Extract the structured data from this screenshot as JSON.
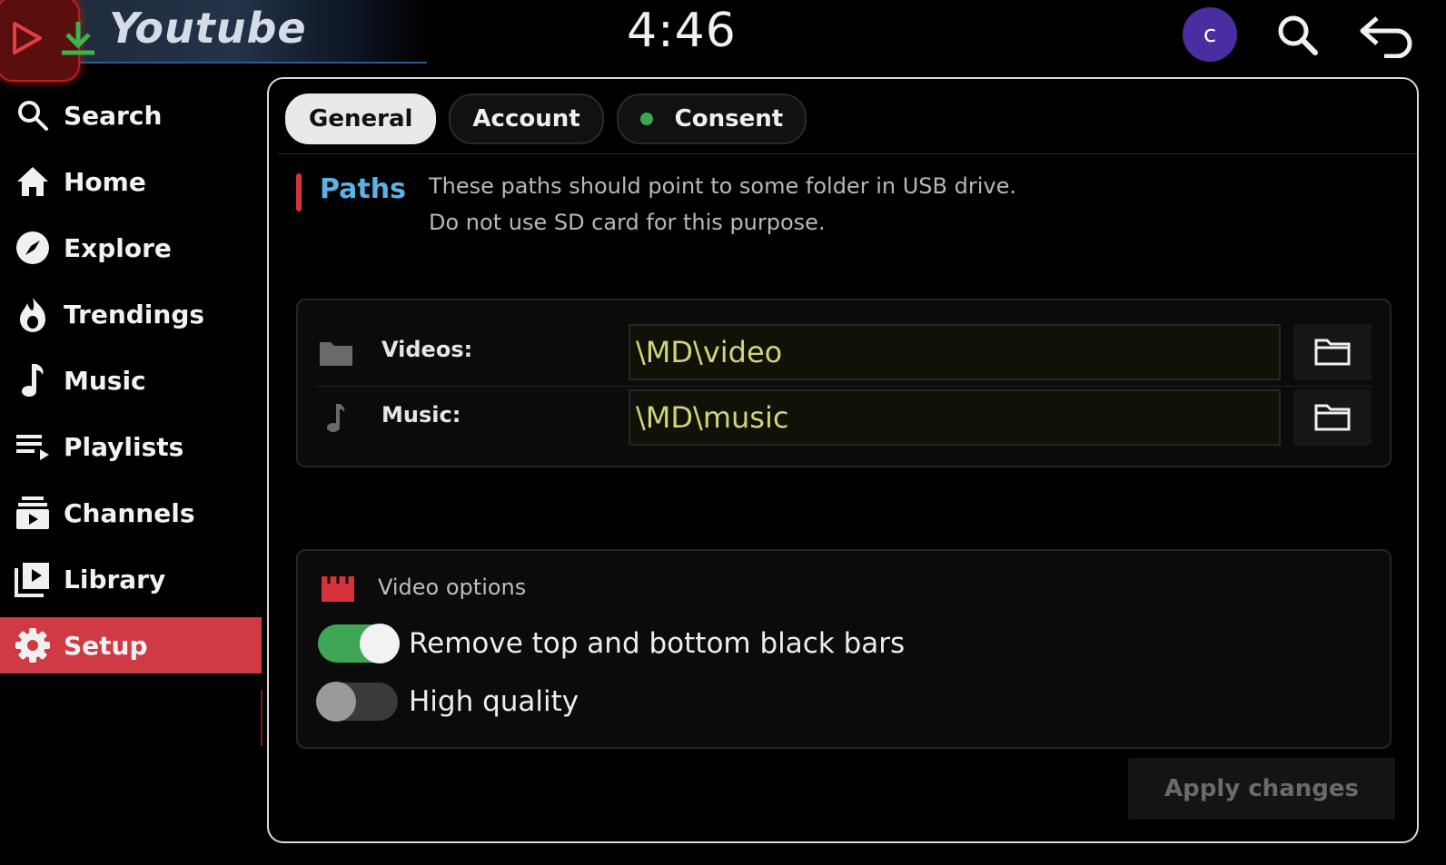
{
  "header": {
    "app_title": "Youtube",
    "clock": "4:46",
    "avatar_letter": "c"
  },
  "sidebar": {
    "items": [
      {
        "label": "Search",
        "icon": "search-icon"
      },
      {
        "label": "Home",
        "icon": "home-icon"
      },
      {
        "label": "Explore",
        "icon": "compass-icon"
      },
      {
        "label": "Trendings",
        "icon": "flame-icon"
      },
      {
        "label": "Music",
        "icon": "music-note-icon"
      },
      {
        "label": "Playlists",
        "icon": "playlist-icon"
      },
      {
        "label": "Channels",
        "icon": "subscriptions-icon"
      },
      {
        "label": "Library",
        "icon": "library-icon"
      },
      {
        "label": "Setup",
        "icon": "gear-icon",
        "active": true
      }
    ]
  },
  "tabs": [
    {
      "label": "General",
      "selected": true
    },
    {
      "label": "Account"
    },
    {
      "label": "Consent",
      "status_color": "#3fa655"
    }
  ],
  "paths": {
    "title": "Paths",
    "description_line1": "These paths should point to some folder in USB drive.",
    "description_line2": "Do not use SD card for this purpose.",
    "rows": [
      {
        "label": "Videos:",
        "value": "\\MD\\video",
        "icon": "folder-icon"
      },
      {
        "label": "Music:",
        "value": "\\MD\\music",
        "icon": "music-note-icon"
      }
    ]
  },
  "video_options": {
    "title": "Video options",
    "toggles": [
      {
        "label": "Remove top and bottom black bars",
        "on": true
      },
      {
        "label": "High quality",
        "on": false
      }
    ]
  },
  "apply_label": "Apply changes",
  "colors": {
    "accent_red": "#cf3a44",
    "link_blue": "#5bb2e6",
    "toggle_green": "#3fa655",
    "path_text": "#d4d27a"
  }
}
